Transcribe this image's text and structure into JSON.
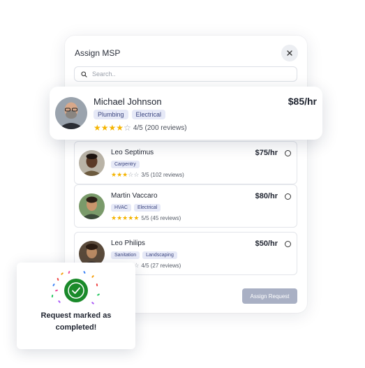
{
  "modal": {
    "title": "Assign MSP",
    "search_placeholder": "Search..",
    "assign_button": "Assign Request"
  },
  "featured": {
    "name": "Michael Johnson",
    "price": "$85/hr",
    "tags": [
      "Plumbing",
      "Electrical"
    ],
    "stars_filled": 4,
    "rating_text": "4/5 (200 reviews)"
  },
  "msps": [
    {
      "name": "Leo Septimus",
      "price": "$75/hr",
      "tags": [
        "Carpentry"
      ],
      "stars_filled": 3,
      "rating_text": "3/5 (102 reviews)"
    },
    {
      "name": "Martin Vaccaro",
      "price": "$80/hr",
      "tags": [
        "HVAC",
        "Electrical"
      ],
      "stars_filled": 5,
      "rating_text": "5/5 (45 reviews)"
    },
    {
      "name": "Leo Philips",
      "price": "$50/hr",
      "tags": [
        "Sanitation",
        "Landscaping"
      ],
      "stars_filled": 4,
      "rating_text": "4/5 (27 reviews)"
    }
  ],
  "toast": {
    "line1": "Request marked as",
    "line2": "completed!"
  },
  "colors": {
    "star": "#f5b400",
    "tag_bg": "#e6e9f7",
    "tag_text": "#3c4680",
    "assign_button_bg": "#a9b0c4",
    "success_green": "#1a8a2a"
  }
}
